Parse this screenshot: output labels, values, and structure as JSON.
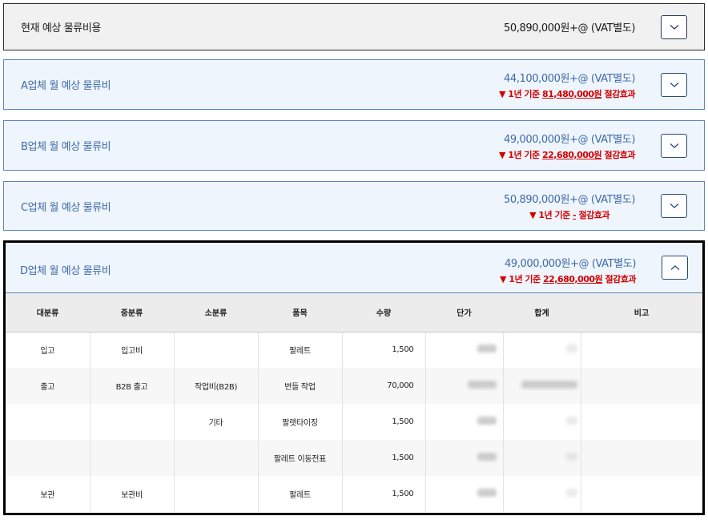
{
  "current": {
    "title": "현재 예상 물류비용",
    "amount": "50,890,000원+@ (VAT별도)"
  },
  "vendors": [
    {
      "title": "A업체 월 예상 물류비",
      "amount": "44,100,000원+@ (VAT별도)",
      "saving_prefix": "▼ 1년 기준 ",
      "saving_value": "81,480,000원",
      "saving_suffix": " 절감효과"
    },
    {
      "title": "B업체 월 예상 물류비",
      "amount": "49,000,000원+@ (VAT별도)",
      "saving_prefix": "▼ 1년 기준 ",
      "saving_value": "22,680,000원",
      "saving_suffix": " 절감효과"
    },
    {
      "title": "C업체 월 예상 물류비",
      "amount": "50,890,000원+@ (VAT별도)",
      "saving_prefix": "▼ 1년 기준 ",
      "saving_value": "-",
      "saving_suffix": " 절감효과"
    },
    {
      "title": "D업체 월 예상 물류비",
      "amount": "49,000,000원+@ (VAT별도)",
      "saving_prefix": "▼ 1년 기준 ",
      "saving_value": "22,680,000원",
      "saving_suffix": " 절감효과"
    }
  ],
  "table": {
    "headers": [
      "대분류",
      "중분류",
      "소분류",
      "품목",
      "수량",
      "단가",
      "합계",
      "비고"
    ],
    "rows": [
      {
        "cat1": "입고",
        "cat2": "입고비",
        "cat3": "",
        "item": "팔레트",
        "qty": "1,500"
      },
      {
        "cat1": "출고",
        "cat2": "B2B 출고",
        "cat3": "작업비(B2B)",
        "item": "번들 작업",
        "qty": "70,000"
      },
      {
        "cat1": "",
        "cat2": "",
        "cat3": "기타",
        "item": "팔렛타이징",
        "qty": "1,500"
      },
      {
        "cat1": "",
        "cat2": "",
        "cat3": "",
        "item": "팔레트 이동전표",
        "qty": "1,500"
      },
      {
        "cat1": "보관",
        "cat2": "보관비",
        "cat3": "",
        "item": "팔레트",
        "qty": "1,500"
      }
    ]
  },
  "icons": {
    "collapsed": "chevron-down-icon",
    "expanded": "chevron-up-icon"
  },
  "colors": {
    "accent": "#3e6aa6",
    "saving": "#d40000",
    "border": "#5a85bd"
  }
}
